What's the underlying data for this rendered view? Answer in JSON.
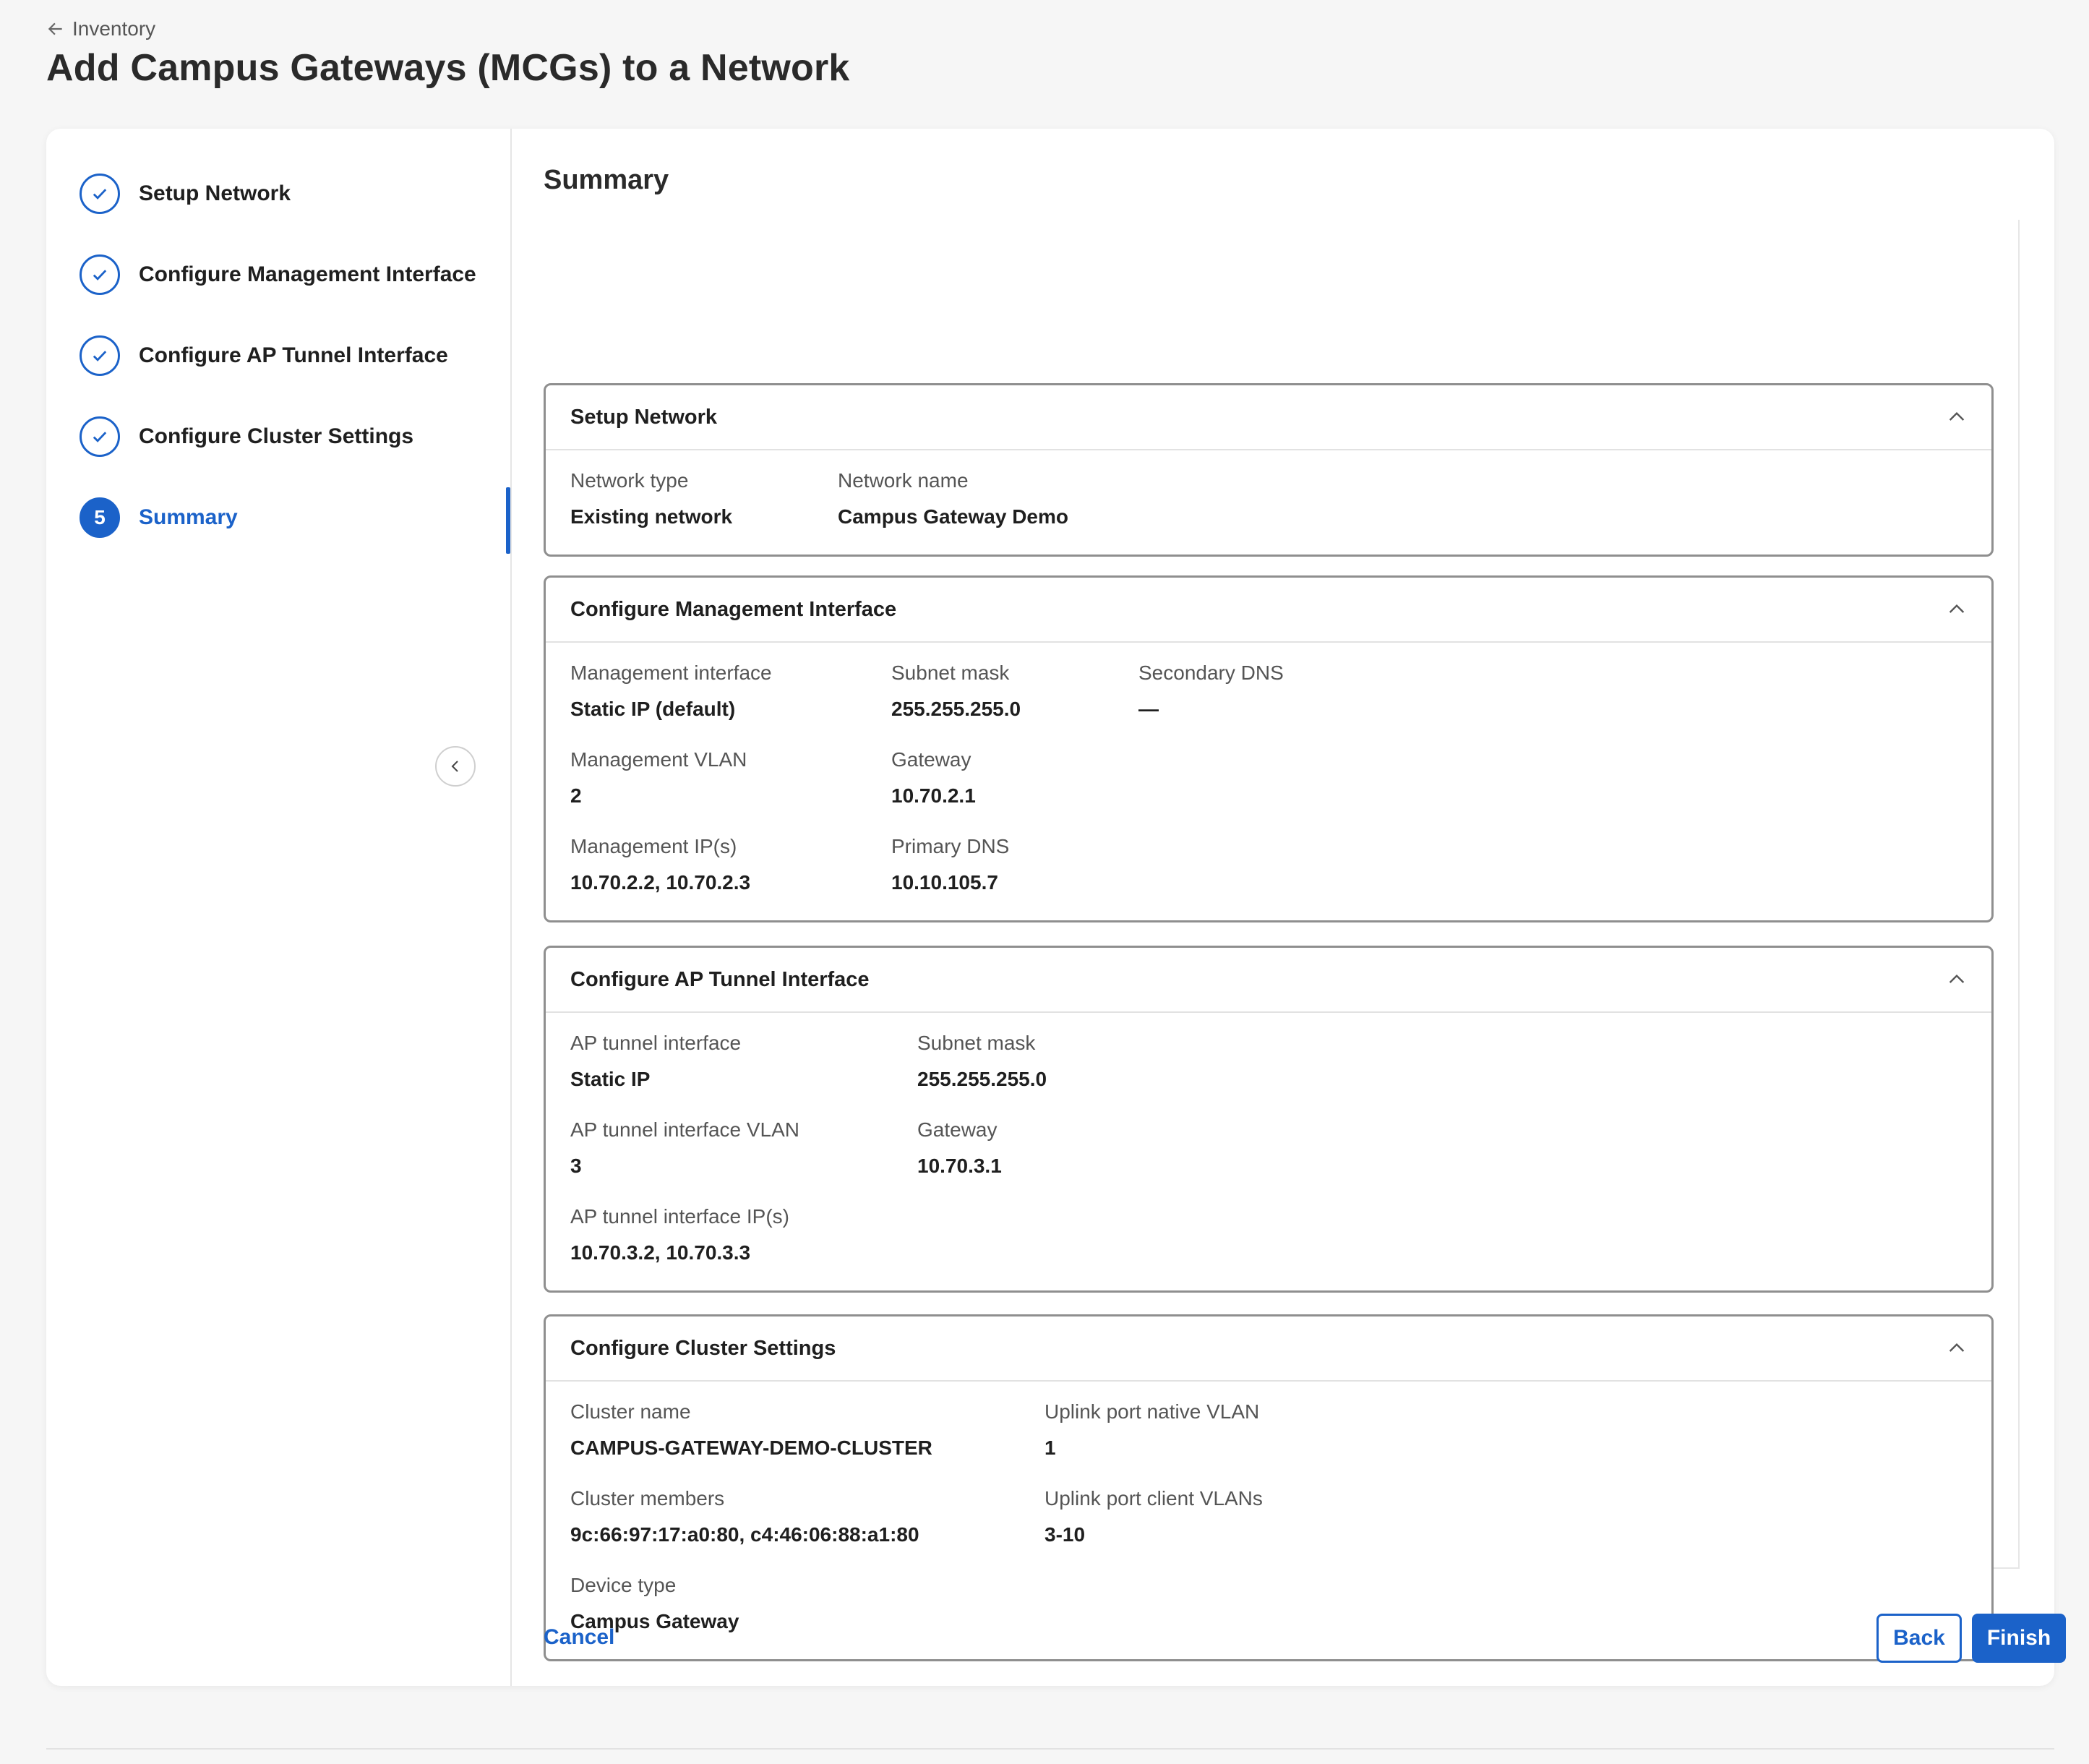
{
  "breadcrumb": {
    "back_label": "Inventory",
    "icon": "arrow-left-icon"
  },
  "page_title": "Add Campus Gateways (MCGs) to a Network",
  "steps": [
    {
      "label": "Setup Network",
      "status": "complete"
    },
    {
      "label": "Configure Management Interface",
      "status": "complete"
    },
    {
      "label": "Configure AP Tunnel Interface",
      "status": "complete"
    },
    {
      "label": "Configure Cluster Settings",
      "status": "complete"
    },
    {
      "label": "Summary",
      "status": "active",
      "number": "5"
    }
  ],
  "summary_title": "Summary",
  "sections": {
    "setup_network": {
      "title": "Setup Network",
      "network_type_label": "Network type",
      "network_type_value": "Existing network",
      "network_name_label": "Network name",
      "network_name_value": "Campus Gateway Demo"
    },
    "management": {
      "title": "Configure Management Interface",
      "mgmt_interface_label": "Management interface",
      "mgmt_interface_value": "Static IP (default)",
      "subnet_label": "Subnet mask",
      "subnet_value": "255.255.255.0",
      "secondary_dns_label": "Secondary DNS",
      "secondary_dns_value": "—",
      "vlan_label": "Management VLAN",
      "vlan_value": "2",
      "gateway_label": "Gateway",
      "gateway_value": "10.70.2.1",
      "ips_label": "Management IP(s)",
      "ips_value": "10.70.2.2, 10.70.2.3",
      "primary_dns_label": "Primary DNS",
      "primary_dns_value": "10.10.105.7"
    },
    "ap_tunnel": {
      "title": "Configure AP Tunnel Interface",
      "interface_label": "AP tunnel interface",
      "interface_value": "Static IP",
      "subnet_label": "Subnet mask",
      "subnet_value": "255.255.255.0",
      "vlan_label": "AP tunnel interface VLAN",
      "vlan_value": "3",
      "gateway_label": "Gateway",
      "gateway_value": "10.70.3.1",
      "ips_label": "AP tunnel interface IP(s)",
      "ips_value": "10.70.3.2, 10.70.3.3"
    },
    "cluster": {
      "title": "Configure Cluster Settings",
      "name_label": "Cluster name",
      "name_value": "CAMPUS-GATEWAY-DEMO-CLUSTER",
      "native_vlan_label": "Uplink port native VLAN",
      "native_vlan_value": "1",
      "members_label": "Cluster members",
      "members_value": "9c:66:97:17:a0:80, c4:46:06:88:a1:80",
      "client_vlans_label": "Uplink port client VLANs",
      "client_vlans_value": "3-10",
      "device_type_label": "Device type",
      "device_type_value": "Campus Gateway"
    }
  },
  "footer": {
    "cancel_label": "Cancel",
    "back_label": "Back",
    "finish_label": "Finish"
  },
  "colors": {
    "accent": "#1b62c9",
    "border": "#8f8f8f",
    "background": "#f6f6f6"
  }
}
